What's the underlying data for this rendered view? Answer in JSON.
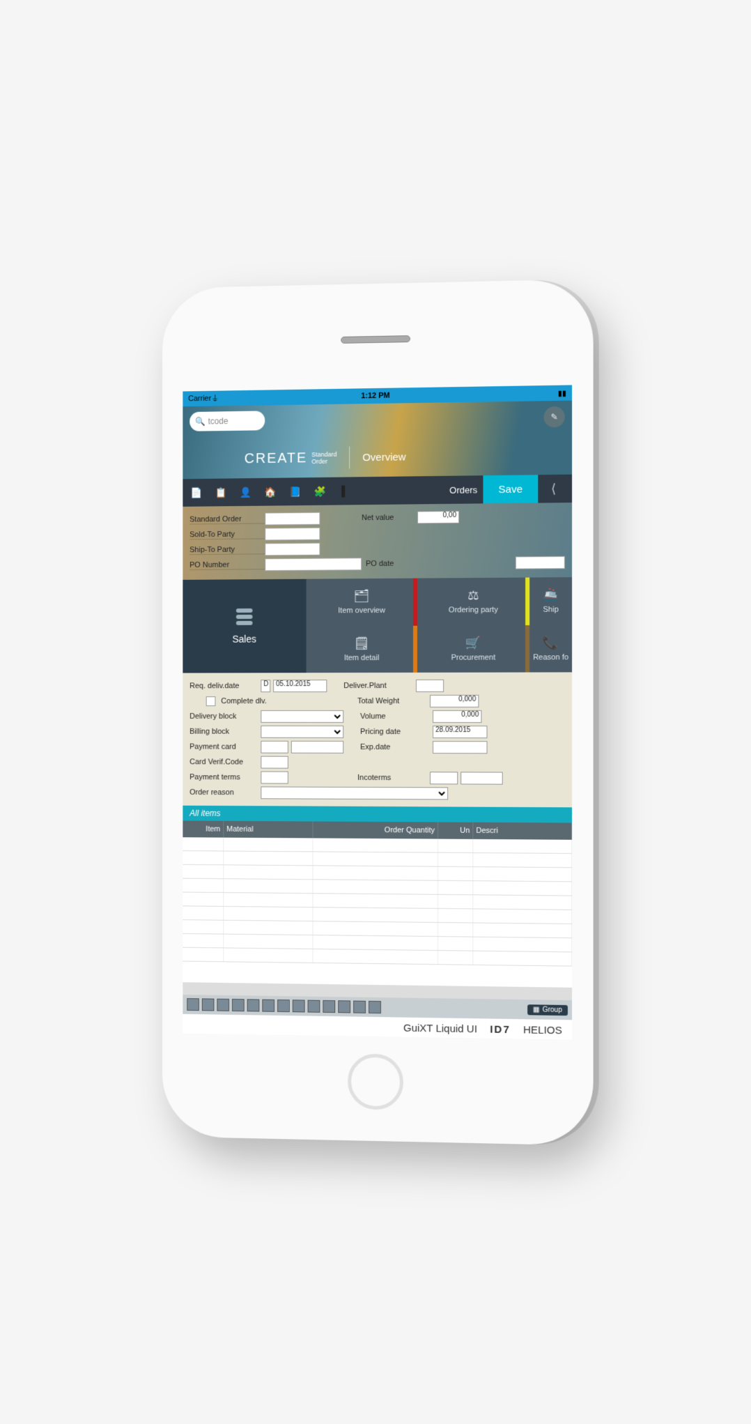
{
  "statusbar": {
    "carrier": "Carrier",
    "time": "1:12 PM"
  },
  "search": {
    "placeholder": "tcode"
  },
  "title": {
    "create": "CREATE",
    "sub1": "Standard",
    "sub2": "Order",
    "overview": "Overview"
  },
  "toolbar": {
    "orders_label": "Orders",
    "save_label": "Save"
  },
  "upper": {
    "standard_order": "Standard Order",
    "sold_to": "Sold-To Party",
    "ship_to": "Ship-To Party",
    "po_number": "PO Number",
    "net_value": "Net value",
    "net_value_val": "0,00",
    "po_date": "PO date"
  },
  "tiles": {
    "sales": "Sales",
    "item_overview": "Item overview",
    "item_detail": "Item detail",
    "ordering_party": "Ordering party",
    "procurement": "Procurement",
    "ship": "Ship",
    "reason": "Reason fo"
  },
  "detail": {
    "req_deliv_date": "Req. deliv.date",
    "req_deliv_date_type": "D",
    "req_deliv_date_val": "05.10.2015",
    "complete_dlv": "Complete dlv.",
    "delivery_block": "Delivery block",
    "billing_block": "Billing block",
    "payment_card": "Payment card",
    "card_verif": "Card Verif.Code",
    "payment_terms": "Payment terms",
    "order_reason": "Order reason",
    "deliver_plant": "Deliver.Plant",
    "total_weight": "Total Weight",
    "total_weight_val": "0,000",
    "volume": "Volume",
    "volume_val": "0,000",
    "pricing_date": "Pricing date",
    "pricing_date_val": "28.09.2015",
    "exp_date": "Exp.date",
    "incoterms": "Incoterms"
  },
  "grid": {
    "title": "All items",
    "cols": {
      "item": "Item",
      "material": "Material",
      "qty": "Order Quantity",
      "un": "Un",
      "desc": "Descri"
    }
  },
  "bottom": {
    "group": "Group"
  },
  "footer": {
    "product": "GuiXT Liquid UI",
    "id": "ID7",
    "server": "HELIOS"
  }
}
